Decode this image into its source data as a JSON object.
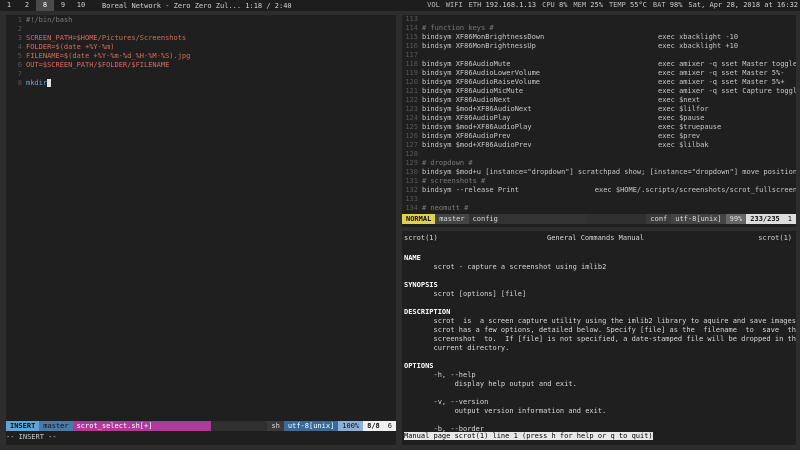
{
  "topbar": {
    "workspaces": [
      "1",
      "2",
      "8",
      "9",
      "10"
    ],
    "active_ws": "8",
    "window_title": "Boreal Network - Zero Zero Zul... 1:18 / 2:40",
    "status": [
      {
        "k": "VOL",
        "v": ""
      },
      {
        "k": "WIFI",
        "v": ""
      },
      {
        "k": "ETH",
        "v": "192.168.1.13"
      },
      {
        "k": "CPU",
        "v": "8%"
      },
      {
        "k": "MEM",
        "v": "25%"
      },
      {
        "k": "TEMP",
        "v": "55°C"
      },
      {
        "k": "BAT",
        "v": "98%"
      },
      {
        "k": "",
        "v": "Sat, Apr 28, 2018 at 16:32"
      }
    ]
  },
  "left_editor": {
    "lines": [
      {
        "n": "1",
        "t": "#!/bin/bash",
        "c": "cm"
      },
      {
        "n": "2",
        "t": "",
        "c": ""
      },
      {
        "n": "3",
        "t": "SCREEN_PATH=$HOME/Pictures/Screenshots",
        "c": "var"
      },
      {
        "n": "4",
        "t": "FOLDER=$(date +%Y-%m)",
        "c": "var"
      },
      {
        "n": "5",
        "t": "FILENAME=$(date +%Y-%m-%d_%H-%M-%S).jpg",
        "c": "var"
      },
      {
        "n": "6",
        "t": "OUT=$SCREEN_PATH/$FOLDER/$FILENAME",
        "c": "var"
      },
      {
        "n": "7",
        "t": "",
        "c": ""
      },
      {
        "n": "8",
        "t": "mkdir",
        "c": "blue"
      }
    ],
    "status": {
      "mode": "INSERT",
      "branch": "master",
      "file": "scrot_select.sh[+]",
      "ft": "sh",
      "enc": "utf-8[unix]",
      "pct": "100%",
      "pos": "8/8",
      "col": "6"
    },
    "cmdline": "-- INSERT --"
  },
  "right_editor": {
    "lines": [
      {
        "n": "113",
        "t": "",
        "c": ""
      },
      {
        "n": "114",
        "t": "# function keys #",
        "c": "cm"
      },
      {
        "n": "115",
        "t": "bindsym XF86MonBrightnessDown                           exec xbacklight -10",
        "c": ""
      },
      {
        "n": "116",
        "t": "bindsym XF86MonBrightnessUp                             exec xbacklight +10",
        "c": ""
      },
      {
        "n": "117",
        "t": "",
        "c": ""
      },
      {
        "n": "118",
        "t": "bindsym XF86AudioMute                                   exec amixer -q sset Master toggle",
        "c": ""
      },
      {
        "n": "119",
        "t": "bindsym XF86AudioLowerVolume                            exec amixer -q sset Master 5%-",
        "c": ""
      },
      {
        "n": "120",
        "t": "bindsym XF86AudioRaiseVolume                            exec amixer -q sset Master 5%+",
        "c": ""
      },
      {
        "n": "121",
        "t": "bindsym XF86AudioMicMute                                exec amixer -q sset Capture toggle",
        "c": ""
      },
      {
        "n": "122",
        "t": "bindsym XF86AudioNext                                   exec $next",
        "c": ""
      },
      {
        "n": "123",
        "t": "bindsym $mod+XF86AudioNext                              exec $lilfor",
        "c": ""
      },
      {
        "n": "124",
        "t": "bindsym XF86AudioPlay                                   exec $pause",
        "c": ""
      },
      {
        "n": "125",
        "t": "bindsym $mod+XF86AudioPlay                              exec $truepause",
        "c": ""
      },
      {
        "n": "126",
        "t": "bindsym XF86AudioPrev                                   exec $prev",
        "c": ""
      },
      {
        "n": "127",
        "t": "bindsym $mod+XF86AudioPrev                              exec $lilbak",
        "c": ""
      },
      {
        "n": "128",
        "t": "",
        "c": ""
      },
      {
        "n": "129",
        "t": "# dropdown #",
        "c": "cm"
      },
      {
        "n": "130",
        "t": "bindsym $mod+u [instance=\"dropdown\"] scratchpad show; [instance=\"dropdown\"] move position cen",
        "c": ""
      },
      {
        "n": "131",
        "t": "# screenshots #",
        "c": "cm"
      },
      {
        "n": "132",
        "t": "bindsym --release Print                  exec $HOME/.scripts/screenshots/scrot_fullscreen.sh",
        "c": ""
      },
      {
        "n": "133",
        "t": "",
        "c": ""
      },
      {
        "n": "134",
        "t": "# neomutt #",
        "c": "cm"
      }
    ],
    "status": {
      "mode": "NORMAL",
      "branch": "master",
      "file": "config",
      "ft": "conf",
      "enc": "utf-8[unix]",
      "pct": "99%",
      "pos": "233/235",
      "col": "1"
    }
  },
  "man": {
    "header_left": "scrot(1)",
    "header_center": "General Commands Manual",
    "header_right": "scrot(1)",
    "lines": [
      "",
      "NAME",
      "       scrot - capture a screenshot using imlib2",
      "",
      "SYNOPSIS",
      "       scrot [options] [file]",
      "",
      "DESCRIPTION",
      "       scrot  is  a screen capture utility using the imlib2 library to aquire and save images.",
      "       scrot has a few options, detailed below. Specify [file] as the  filename  to  save  the",
      "       screenshot  to.  If [file] is not specified, a date-stamped file will be dropped in the",
      "       current directory.",
      "",
      "OPTIONS",
      "       -h, --help",
      "            display help output and exit.",
      "",
      "       -v, --version",
      "            output version information and exit.",
      "",
      "       -b, --border"
    ],
    "prompt": "Manual page scrot(1) line 1 (press h for help or q to quit)"
  }
}
